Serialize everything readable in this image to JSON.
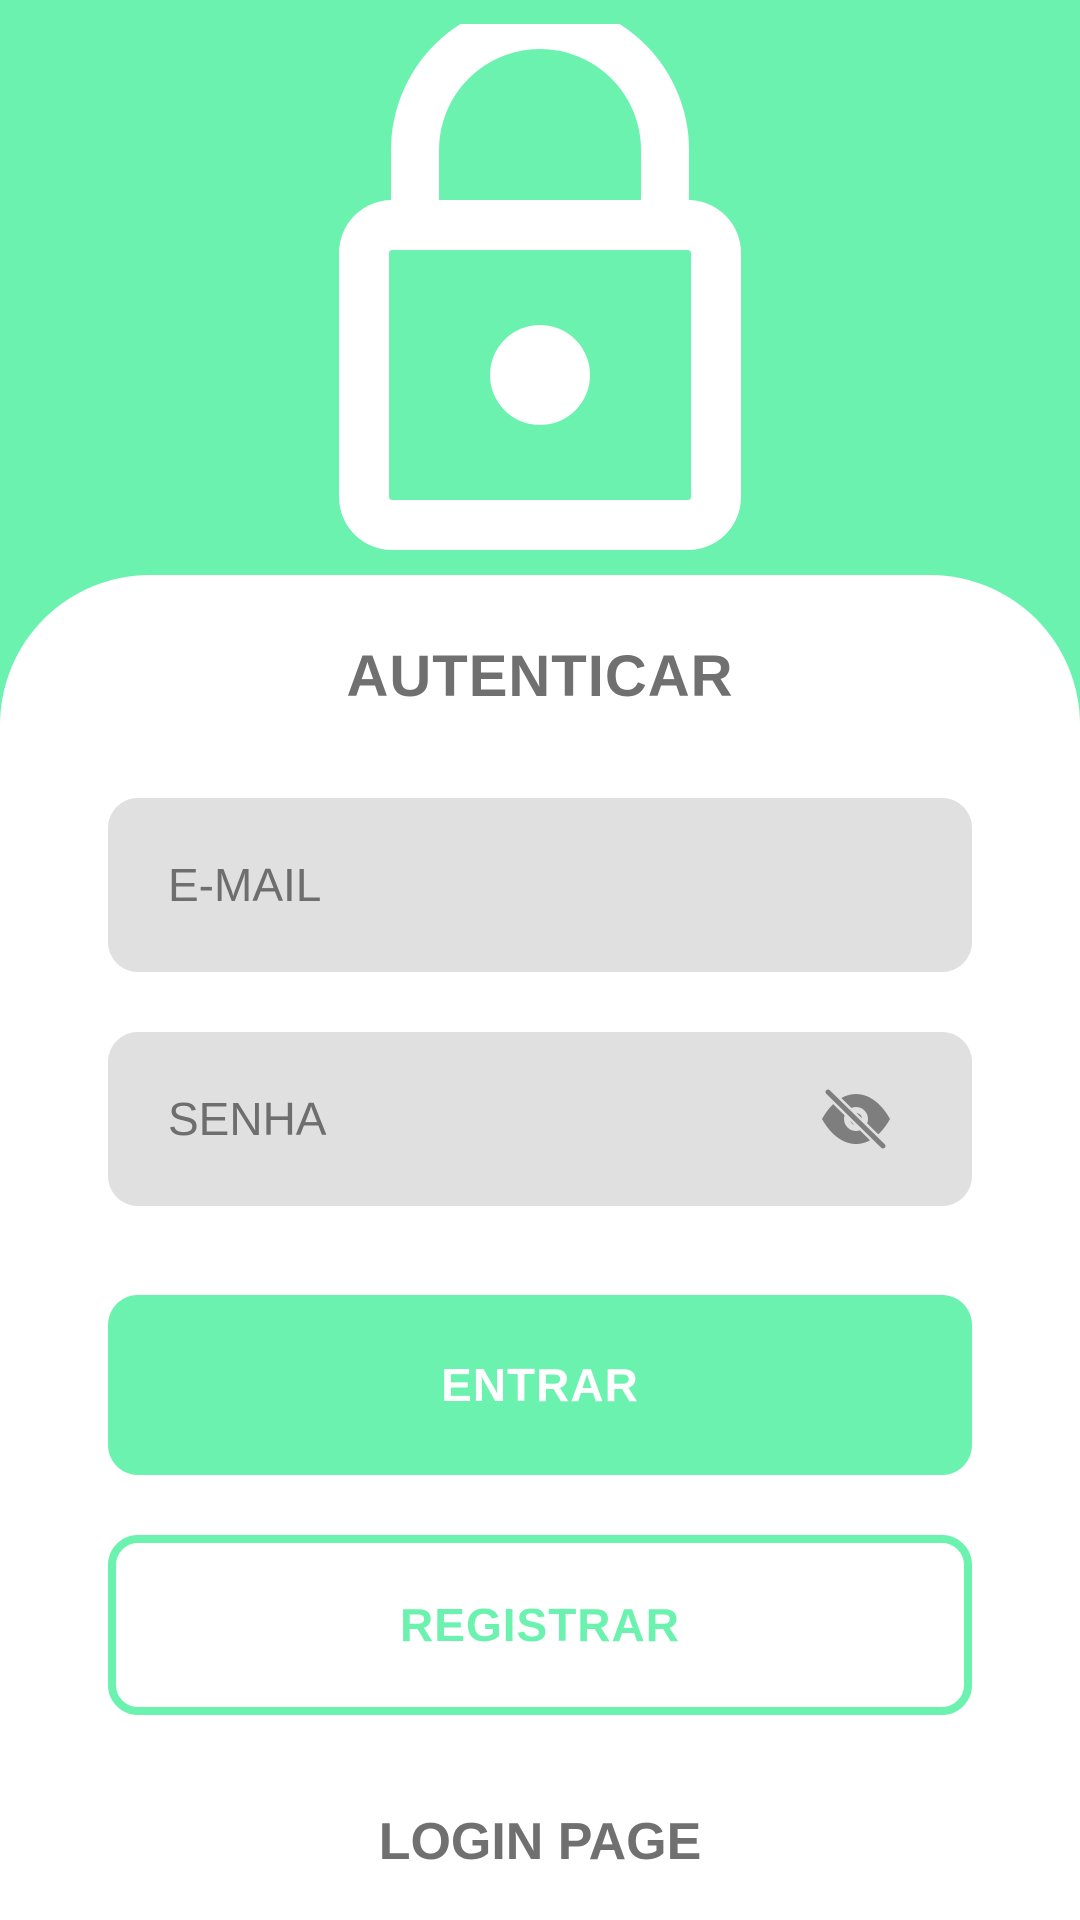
{
  "header": {
    "icon": "lock-icon",
    "background_color": "#6cf2af"
  },
  "card": {
    "title": "AUTENTICAR"
  },
  "form": {
    "email_placeholder": "E-MAIL",
    "password_placeholder": "SENHA",
    "visibility_icon": "eye-off-icon"
  },
  "buttons": {
    "login_label": "ENTRAR",
    "register_label": "REGISTRAR"
  },
  "footer": {
    "title": "LOGIN PAGE"
  },
  "colors": {
    "accent": "#6cf2af",
    "field_bg": "#e0e0e0",
    "text_gray": "#707070"
  }
}
